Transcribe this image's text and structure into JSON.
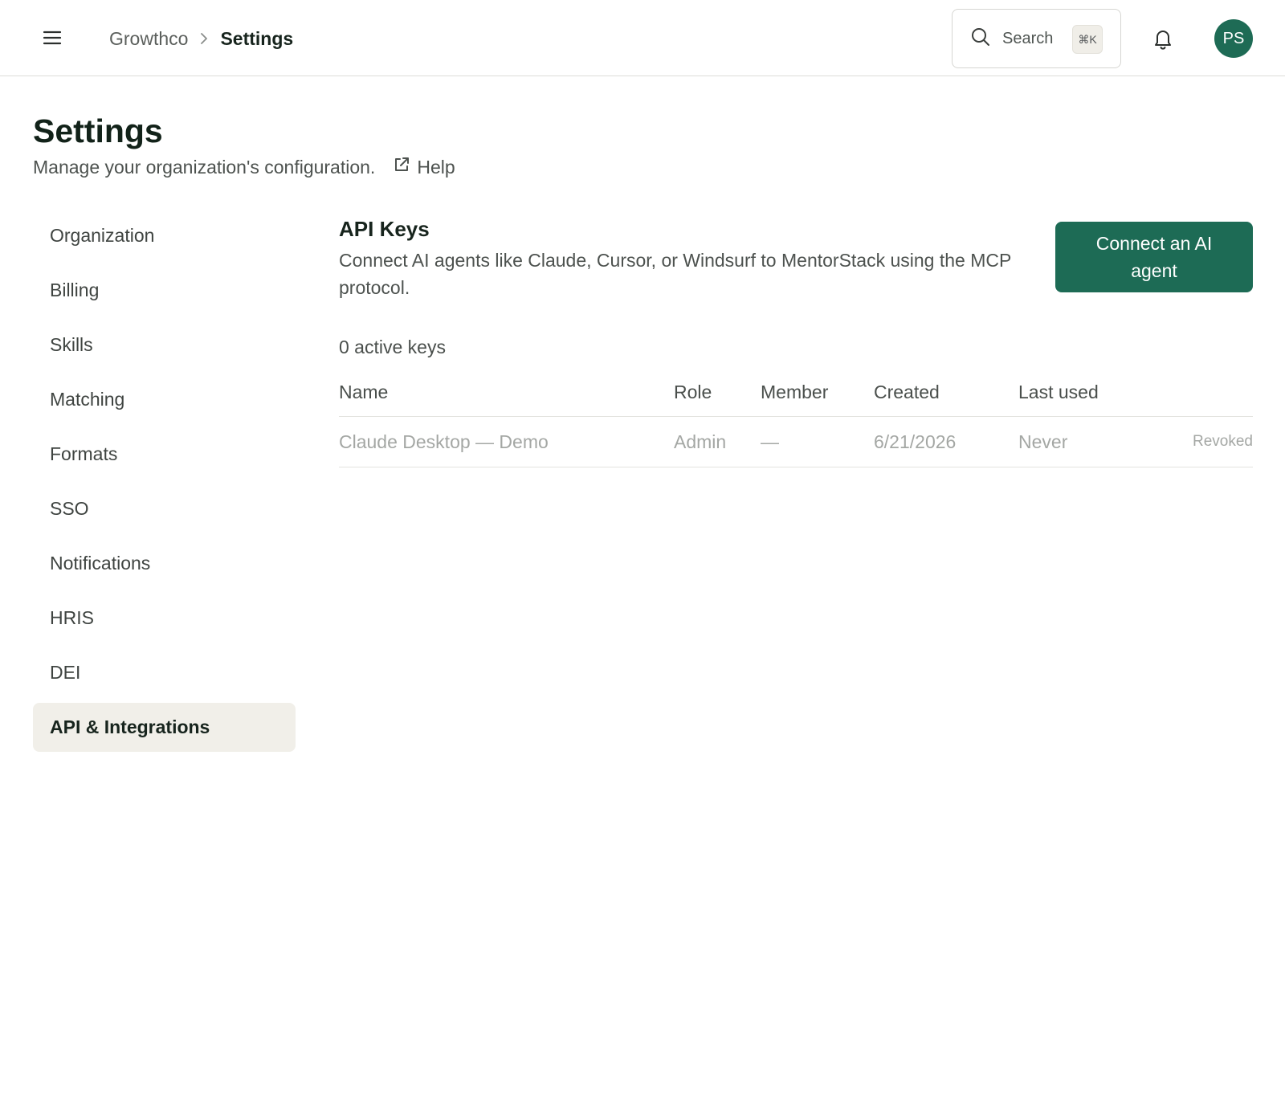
{
  "topbar": {
    "breadcrumb": {
      "org": "Growthco",
      "current": "Settings"
    },
    "search": {
      "label": "Search",
      "shortcut": "⌘K"
    },
    "avatar_initials": "PS"
  },
  "header": {
    "title": "Settings",
    "subtitle": "Manage your organization's configuration.",
    "help_label": "Help"
  },
  "sidebar": {
    "items": [
      {
        "label": "Organization",
        "active": false
      },
      {
        "label": "Billing",
        "active": false
      },
      {
        "label": "Skills",
        "active": false
      },
      {
        "label": "Matching",
        "active": false
      },
      {
        "label": "Formats",
        "active": false
      },
      {
        "label": "SSO",
        "active": false
      },
      {
        "label": "Notifications",
        "active": false
      },
      {
        "label": "HRIS",
        "active": false
      },
      {
        "label": "DEI",
        "active": false
      },
      {
        "label": "API & Integrations",
        "active": true
      }
    ]
  },
  "api_keys": {
    "title": "API Keys",
    "description": "Connect AI agents like Claude, Cursor, or Windsurf to MentorStack using the MCP protocol.",
    "connect_button": "Connect an AI agent",
    "active_count": "0 active keys",
    "columns": {
      "name": "Name",
      "role": "Role",
      "member": "Member",
      "created": "Created",
      "last_used": "Last used"
    },
    "rows": [
      {
        "name": "Claude Desktop — Demo",
        "role": "Admin",
        "member": "—",
        "created": "6/21/2026",
        "last_used": "Never",
        "status": "Revoked"
      }
    ]
  },
  "colors": {
    "accent": "#1d6b55",
    "active_nav_bg": "#f1efe9",
    "muted_text": "#a4a7a4"
  }
}
